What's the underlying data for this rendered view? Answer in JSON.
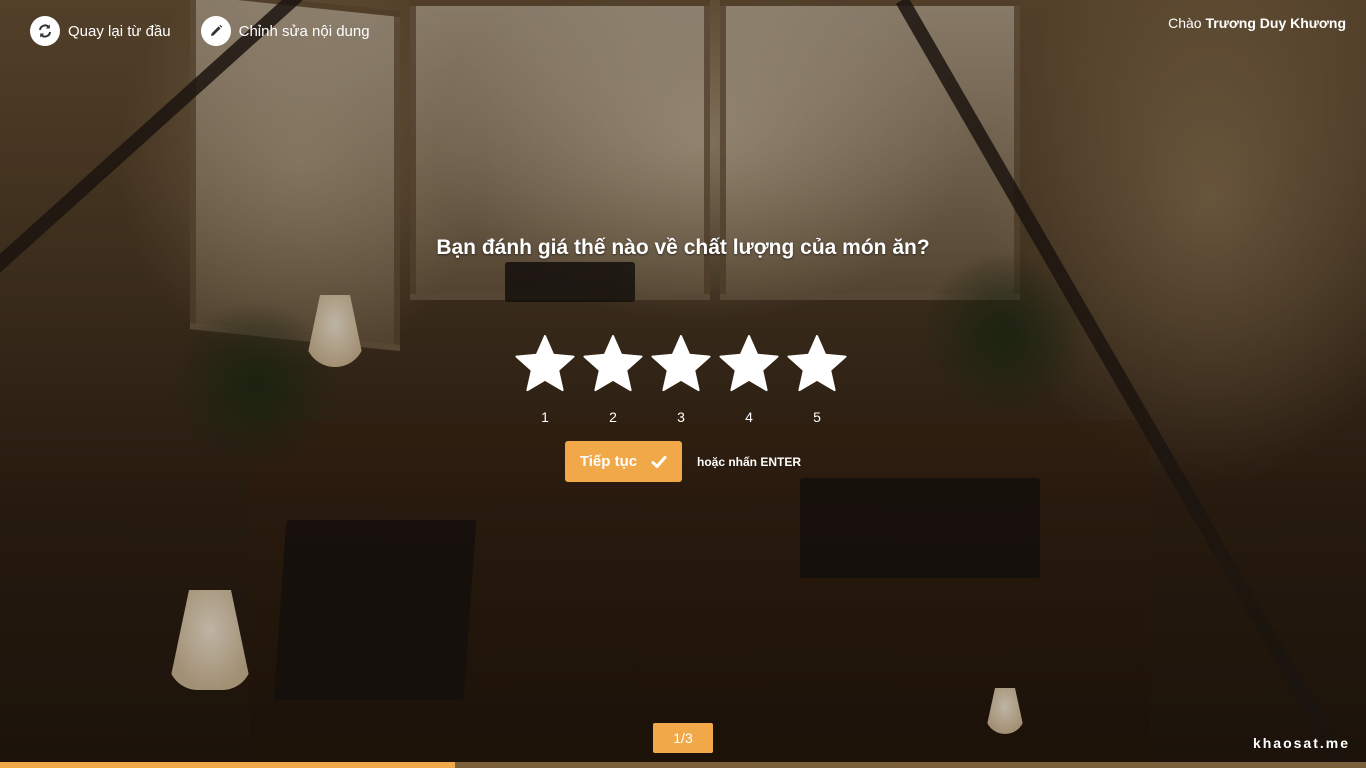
{
  "header": {
    "restart_label": "Quay lại từ đầu",
    "edit_label": "Chỉnh sửa nội dung",
    "greeting_prefix": "Chào",
    "user_name": "Trương Duy Khương"
  },
  "question": {
    "text": "Bạn đánh giá thế nào về chất lượng của món ăn?",
    "rating_labels": [
      "1",
      "2",
      "3",
      "4",
      "5"
    ]
  },
  "actions": {
    "continue_label": "Tiếp tục",
    "enter_hint": "hoặc nhấn ENTER"
  },
  "footer": {
    "pager": "1/3",
    "brand": "khaosat.me",
    "progress_fraction": 0.333
  },
  "colors": {
    "accent": "#f0a848",
    "text": "#ffffff"
  },
  "icons": {
    "restart": "refresh-icon",
    "edit": "pencil-icon",
    "continue": "check-icon",
    "rating": "star-icon"
  }
}
